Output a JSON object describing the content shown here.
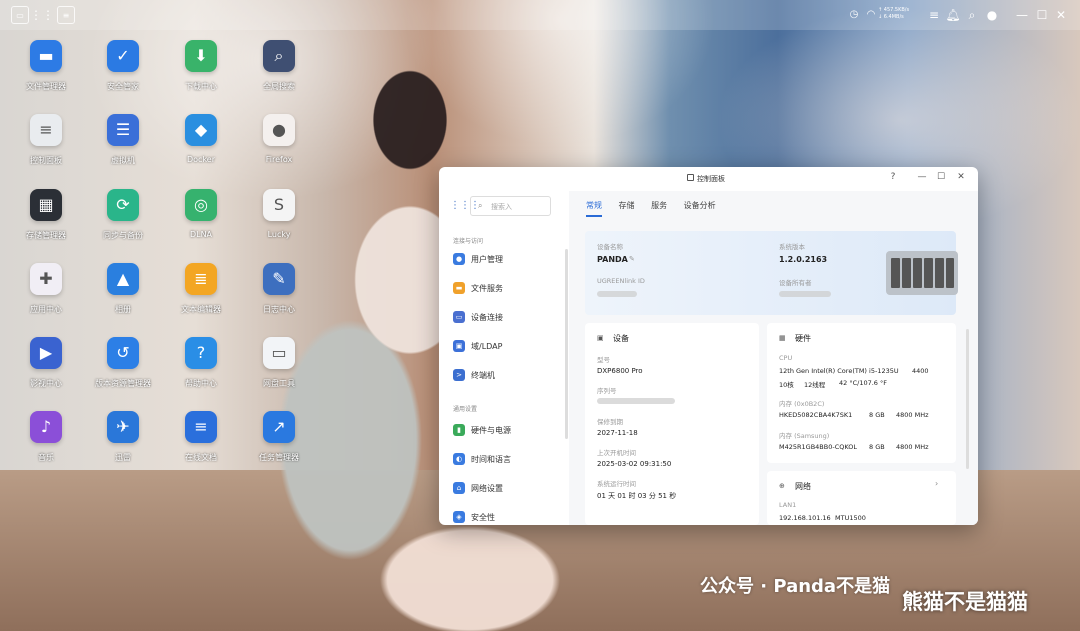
{
  "topbar": {
    "speed_up": "↑ 457.5KB/s",
    "speed_down": "↓ 6.4MB/s"
  },
  "desktop": [
    {
      "label": "文件管理器",
      "icon": "folder-icon",
      "color": "#2d7be5",
      "glyph": "▬"
    },
    {
      "label": "安全管家",
      "icon": "shield-icon",
      "color": "#2b7ae3",
      "glyph": "✓"
    },
    {
      "label": "下载中心",
      "icon": "download-icon",
      "color": "#39b36a",
      "glyph": "⬇"
    },
    {
      "label": "全局搜索",
      "icon": "search-icon",
      "color": "#3f4f72",
      "glyph": "⌕"
    },
    {
      "label": "控制面板",
      "icon": "sliders-icon",
      "color": "#e9ecef",
      "glyph": "≡"
    },
    {
      "label": "虚拟机",
      "icon": "server-icon",
      "color": "#3a6fd8",
      "glyph": "☰"
    },
    {
      "label": "Docker",
      "icon": "docker-icon",
      "color": "#2a8fe0",
      "glyph": "◆"
    },
    {
      "label": "Firefox",
      "icon": "firefox-icon",
      "color": "#f4f0ee",
      "glyph": "●"
    },
    {
      "label": "存储管理器",
      "icon": "storage-icon",
      "color": "#2b2f36",
      "glyph": "▦"
    },
    {
      "label": "同步与备份",
      "icon": "sync-icon",
      "color": "#2ab58a",
      "glyph": "⟳"
    },
    {
      "label": "DLNA",
      "icon": "dlna-icon",
      "color": "#36b26e",
      "glyph": "◎"
    },
    {
      "label": "Lucky",
      "icon": "lucky-icon",
      "color": "#f4f4f4",
      "glyph": "S"
    },
    {
      "label": "应用中心",
      "icon": "app-center-icon",
      "color": "#f1eef5",
      "glyph": "✚"
    },
    {
      "label": "相册",
      "icon": "photo-icon",
      "color": "#2a7fdf",
      "glyph": "▲"
    },
    {
      "label": "文本编辑器",
      "icon": "text-editor-icon",
      "color": "#f3a623",
      "glyph": "≣"
    },
    {
      "label": "日志中心",
      "icon": "log-icon",
      "color": "#3d6fbf",
      "glyph": "✎"
    },
    {
      "label": "影视中心",
      "icon": "video-icon",
      "color": "#3a63d0",
      "glyph": "▶"
    },
    {
      "label": "版本资源管理器",
      "icon": "version-icon",
      "color": "#2c7fe6",
      "glyph": "↺"
    },
    {
      "label": "帮助中心",
      "icon": "help-icon",
      "color": "#2a8ee6",
      "glyph": "?"
    },
    {
      "label": "网盘工具",
      "icon": "cloud-drive-icon",
      "color": "#f2f4f7",
      "glyph": "▭"
    },
    {
      "label": "音乐",
      "icon": "music-icon",
      "color": "#8b4fd8",
      "glyph": "♪"
    },
    {
      "label": "迅雷",
      "icon": "thunder-icon",
      "color": "#2a77d9",
      "glyph": "✈"
    },
    {
      "label": "在线文档",
      "icon": "online-doc-icon",
      "color": "#2a6fdc",
      "glyph": "≡"
    },
    {
      "label": "任务管理器",
      "icon": "task-manager-icon",
      "color": "#2a79e0",
      "glyph": "↗"
    }
  ],
  "window": {
    "title": "控制面板",
    "help": "?",
    "minimize": "—",
    "maximize": "☐",
    "close": "✕",
    "search_placeholder": "搜索入",
    "sections": [
      "连接与访问",
      "通用设置"
    ],
    "nav": [
      {
        "label": "用户管理",
        "icon": "user-icon",
        "color": "#3a7be0",
        "glyph": "●"
      },
      {
        "label": "文件服务",
        "icon": "folder-service-icon",
        "color": "#f0a12b",
        "glyph": "▬"
      },
      {
        "label": "设备连接",
        "icon": "device-connect-icon",
        "color": "#4a6fd0",
        "glyph": "▭"
      },
      {
        "label": "域/LDAP",
        "icon": "ldap-icon",
        "color": "#3c70d8",
        "glyph": "▣"
      },
      {
        "label": "终端机",
        "icon": "terminal-icon",
        "color": "#3c6fd0",
        "glyph": ">"
      },
      {
        "label": "硬件与电源",
        "icon": "power-icon",
        "color": "#3aaa5a",
        "glyph": "▮"
      },
      {
        "label": "时间和语言",
        "icon": "globe-icon",
        "color": "#3a7be0",
        "glyph": "◐"
      },
      {
        "label": "网络设置",
        "icon": "network-icon",
        "color": "#3a7be0",
        "glyph": "⌂"
      },
      {
        "label": "安全性",
        "icon": "security-icon",
        "color": "#3a7be0",
        "glyph": "◈"
      }
    ],
    "tabs": [
      "常规",
      "存储",
      "服务",
      "设备分析"
    ],
    "overview": {
      "device_name_k": "设备名称",
      "device_name": "PANDA",
      "sys_ver_k": "系统版本",
      "sys_ver": "1.2.0.2163",
      "ugreen_id_k": "UGREENlink ID",
      "owner_k": "设备所有者"
    },
    "device": {
      "title": "设备",
      "model_k": "型号",
      "model": "DXP6800 Pro",
      "serial_k": "序列号",
      "warranty_k": "保修到期",
      "warranty": "2027-11-18",
      "boot_k": "上次开机时间",
      "boot": "2025-03-02 09:31:50",
      "uptime_k": "系统运行时间",
      "uptime": "01 天 01 时 03 分 51 秒"
    },
    "hardware": {
      "title": "硬件",
      "cpu_k": "CPU",
      "cpu": "12th Gen Intel(R) Core(TM) i5-1235U",
      "cpu_freq": "4400",
      "cpu_cores": "10核",
      "cpu_threads": "12线程",
      "cpu_temp": "42 °C/107.6 °F",
      "mem1_k": "内存 (0x0B2C)",
      "mem1": "HKED5082CBA4K7SK1",
      "mem1_size": "8 GB",
      "mem1_speed": "4800 MHz",
      "mem2_k": "内存 (Samsung)",
      "mem2": "M425R1GB4BB0-CQKOL",
      "mem2_size": "8 GB",
      "mem2_speed": "4800 MHz"
    },
    "network": {
      "title": "网络",
      "lan_k": "LAN1",
      "lan_ip": "192.168.101.16",
      "lan_mtu": "MTU1500",
      "arrow": "›"
    }
  },
  "watermark": {
    "account": "公众号 · Panda不是猫",
    "author": "熊猫不是猫猫"
  }
}
